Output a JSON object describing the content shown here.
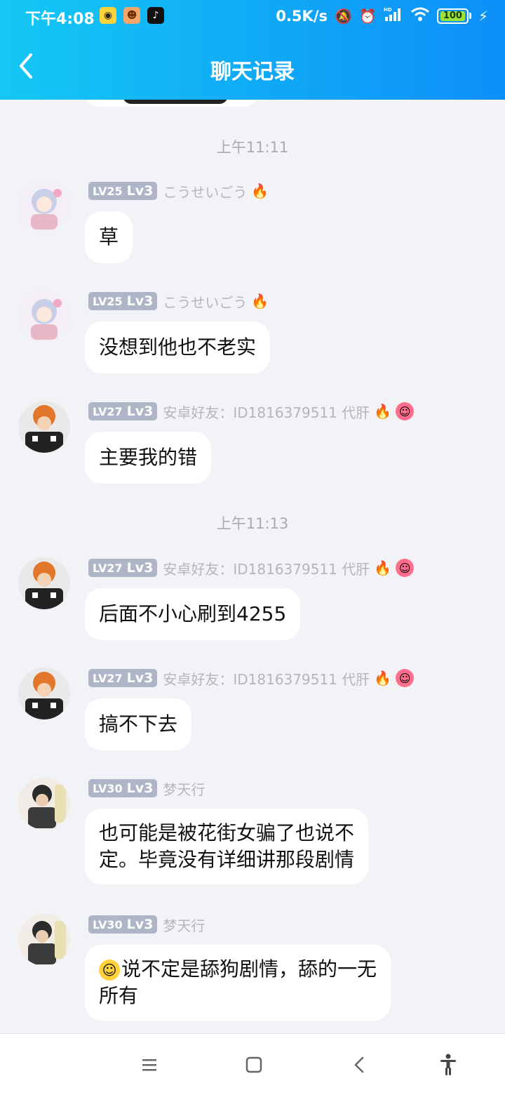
{
  "status_bar": {
    "time": "下午4:08",
    "speed": "0.5K/s",
    "network": "HD",
    "battery": "100",
    "icons": [
      "game-app-icon",
      "cat-app-icon",
      "tiktok-icon",
      "mute-bell-icon",
      "alarm-icon",
      "signal-icon",
      "wifi-icon",
      "battery-icon",
      "charging-icon"
    ]
  },
  "header": {
    "title": "聊天记录",
    "back_icon": "chevron-left-icon",
    "bg_from": "#14c8f4",
    "bg_to": "#0d8ff8"
  },
  "messages": [
    {
      "time": "上午11:11"
    },
    {
      "level": "LV25",
      "lv": "Lv3",
      "name": "こうせいごう",
      "badges": [
        "fire"
      ],
      "lines": [
        "草"
      ]
    },
    {
      "level": "LV25",
      "lv": "Lv3",
      "name": "こうせいごう",
      "badges": [
        "fire"
      ],
      "lines": [
        "没想到他也不老实"
      ]
    },
    {
      "level": "LV27",
      "lv": "Lv3",
      "name": "安卓好友：ID1816379511  代肝",
      "badges": [
        "fire",
        "face"
      ],
      "lines": [
        "主要我的错"
      ]
    },
    {
      "time": "上午11:13"
    },
    {
      "level": "LV27",
      "lv": "Lv3",
      "name": "安卓好友：ID1816379511  代肝",
      "badges": [
        "fire",
        "face"
      ],
      "lines": [
        "后面不小心刷到4255"
      ]
    },
    {
      "level": "LV27",
      "lv": "Lv3",
      "name": "安卓好友：ID1816379511  代肝",
      "badges": [
        "fire",
        "face"
      ],
      "lines": [
        "搞不下去"
      ]
    },
    {
      "level": "LV30",
      "lv": "Lv3",
      "name": "梦天行",
      "badges": [],
      "lines": [
        "也可能是被花街女骗了也说不",
        "定。毕竟没有详细讲那段剧情"
      ]
    },
    {
      "level": "LV30",
      "lv": "Lv3",
      "name": "梦天行",
      "badges": [],
      "emoji": "smirk-emoji",
      "lines": [
        "说不定是舔狗剧情，舔的一无",
        "所有"
      ]
    }
  ],
  "nav_bar": {
    "icons": [
      "menu-icon",
      "home-icon",
      "back-icon",
      "accessibility-icon"
    ]
  }
}
